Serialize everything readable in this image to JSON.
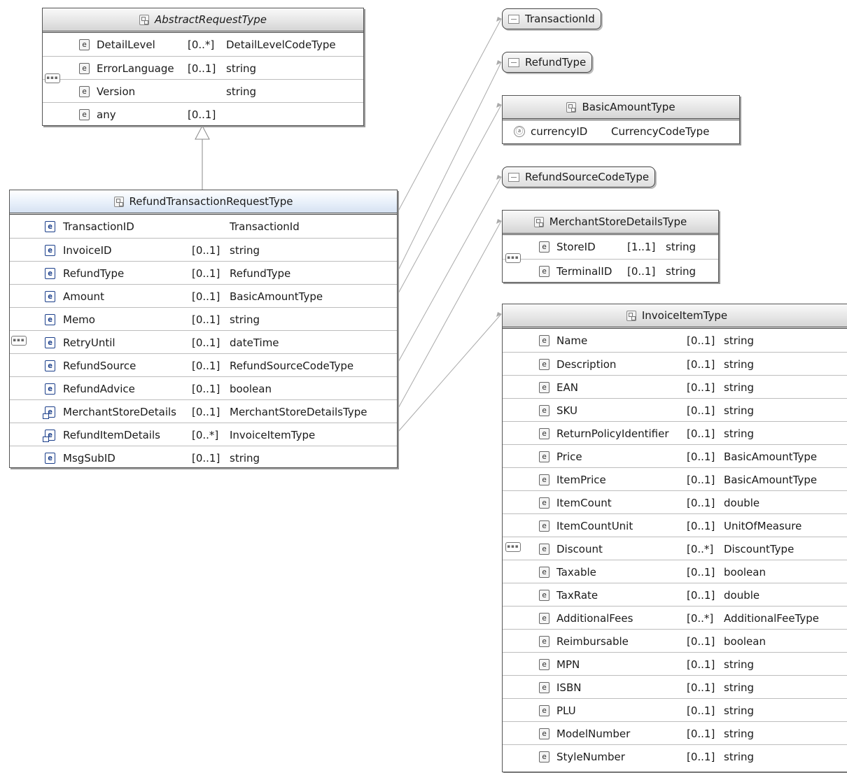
{
  "abstract": {
    "title": "AbstractRequestType",
    "rows": [
      {
        "name": "DetailLevel",
        "card": "[0..*]",
        "type": "DetailLevelCodeType"
      },
      {
        "name": "ErrorLanguage",
        "card": "[0..1]",
        "type": "string"
      },
      {
        "name": "Version",
        "card": "",
        "type": "string"
      },
      {
        "name": "any",
        "card": "[0..1]",
        "type": ""
      }
    ]
  },
  "main": {
    "title": "RefundTransactionRequestType",
    "rows": [
      {
        "name": "TransactionID",
        "card": "",
        "type": "TransactionId"
      },
      {
        "name": "InvoiceID",
        "card": "[0..1]",
        "type": "string"
      },
      {
        "name": "RefundType",
        "card": "[0..1]",
        "type": "RefundType"
      },
      {
        "name": "Amount",
        "card": "[0..1]",
        "type": "BasicAmountType"
      },
      {
        "name": "Memo",
        "card": "[0..1]",
        "type": "string"
      },
      {
        "name": "RetryUntil",
        "card": "[0..1]",
        "type": "dateTime"
      },
      {
        "name": "RefundSource",
        "card": "[0..1]",
        "type": "RefundSourceCodeType"
      },
      {
        "name": "RefundAdvice",
        "card": "[0..1]",
        "type": "boolean"
      },
      {
        "name": "MerchantStoreDetails",
        "card": "[0..1]",
        "type": "MerchantStoreDetailsType"
      },
      {
        "name": "RefundItemDetails",
        "card": "[0..*]",
        "type": "InvoiceItemType"
      },
      {
        "name": "MsgSubID",
        "card": "[0..1]",
        "type": "string"
      }
    ]
  },
  "simple_types": {
    "transaction_id": "TransactionId",
    "refund_type": "RefundType",
    "refund_source": "RefundSourceCodeType"
  },
  "basic_amount": {
    "title": "BasicAmountType",
    "attr_name": "currencyID",
    "attr_type": "CurrencyCodeType",
    "attr_icon": "ⓐ"
  },
  "merchant": {
    "title": "MerchantStoreDetailsType",
    "rows": [
      {
        "name": "StoreID",
        "card": "[1..1]",
        "type": "string"
      },
      {
        "name": "TerminalID",
        "card": "[0..1]",
        "type": "string"
      }
    ]
  },
  "invoice": {
    "title": "InvoiceItemType",
    "rows": [
      {
        "name": "Name",
        "card": "[0..1]",
        "type": "string"
      },
      {
        "name": "Description",
        "card": "[0..1]",
        "type": "string"
      },
      {
        "name": "EAN",
        "card": "[0..1]",
        "type": "string"
      },
      {
        "name": "SKU",
        "card": "[0..1]",
        "type": "string"
      },
      {
        "name": "ReturnPolicyIdentifier",
        "card": "[0..1]",
        "type": "string"
      },
      {
        "name": "Price",
        "card": "[0..1]",
        "type": "BasicAmountType"
      },
      {
        "name": "ItemPrice",
        "card": "[0..1]",
        "type": "BasicAmountType"
      },
      {
        "name": "ItemCount",
        "card": "[0..1]",
        "type": "double"
      },
      {
        "name": "ItemCountUnit",
        "card": "[0..1]",
        "type": "UnitOfMeasure"
      },
      {
        "name": "Discount",
        "card": "[0..*]",
        "type": "DiscountType"
      },
      {
        "name": "Taxable",
        "card": "[0..1]",
        "type": "boolean"
      },
      {
        "name": "TaxRate",
        "card": "[0..1]",
        "type": "double"
      },
      {
        "name": "AdditionalFees",
        "card": "[0..*]",
        "type": "AdditionalFeeType"
      },
      {
        "name": "Reimbursable",
        "card": "[0..1]",
        "type": "boolean"
      },
      {
        "name": "MPN",
        "card": "[0..1]",
        "type": "string"
      },
      {
        "name": "ISBN",
        "card": "[0..1]",
        "type": "string"
      },
      {
        "name": "PLU",
        "card": "[0..1]",
        "type": "string"
      },
      {
        "name": "ModelNumber",
        "card": "[0..1]",
        "type": "string"
      },
      {
        "name": "StyleNumber",
        "card": "[0..1]",
        "type": "string"
      }
    ]
  },
  "icons": {
    "element": "e",
    "sequence": "sequence-compositor-icon",
    "complex_type": "complex-type-icon",
    "simple_type": "simple-type-icon",
    "any": "any-element-icon",
    "element_ref": "element-reference-icon"
  }
}
